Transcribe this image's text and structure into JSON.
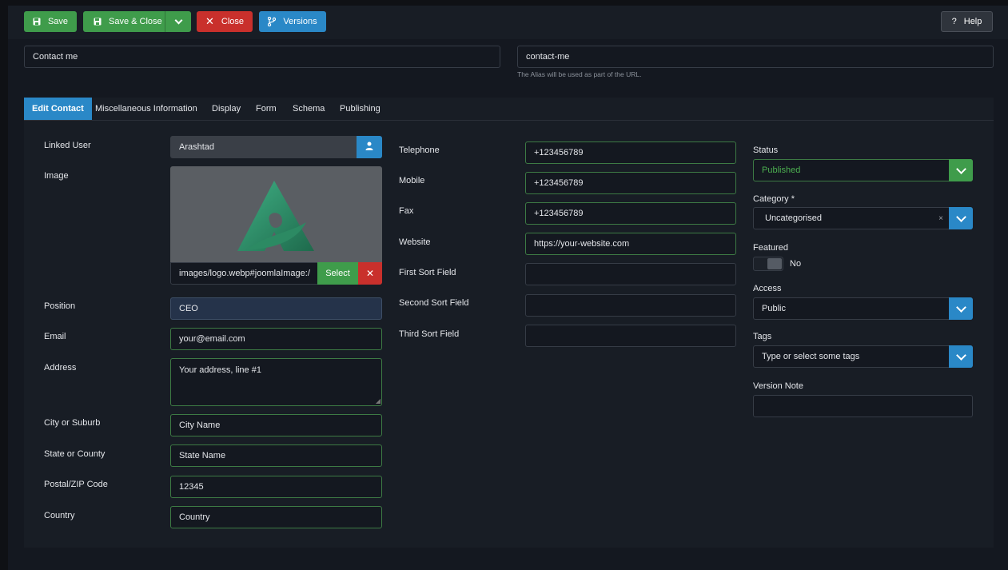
{
  "toolbar": {
    "save": "Save",
    "save_close": "Save & Close",
    "close": "Close",
    "versions": "Versions",
    "help": "Help"
  },
  "title": {
    "value": "Contact me"
  },
  "alias": {
    "value": "contact-me",
    "hint": "The Alias will be used as part of the URL."
  },
  "tabs": [
    "Edit Contact",
    "Miscellaneous Information",
    "Display",
    "Form",
    "Schema",
    "Publishing"
  ],
  "left": {
    "linked_user": {
      "label": "Linked User",
      "value": "Arashtad"
    },
    "image": {
      "label": "Image",
      "path": "images/logo.webp#joomlaImage:/",
      "select": "Select"
    },
    "position": {
      "label": "Position",
      "value": "CEO"
    },
    "email": {
      "label": "Email",
      "value": "your@email.com"
    },
    "address": {
      "label": "Address",
      "value": "Your address, line #1"
    },
    "city": {
      "label": "City or Suburb",
      "value": "City Name"
    },
    "state": {
      "label": "State or County",
      "value": "State Name"
    },
    "postal": {
      "label": "Postal/ZIP Code",
      "value": "12345"
    },
    "country": {
      "label": "Country",
      "value": "Country"
    }
  },
  "middle": {
    "telephone": {
      "label": "Telephone",
      "value": "+123456789"
    },
    "mobile": {
      "label": "Mobile",
      "value": "+123456789"
    },
    "fax": {
      "label": "Fax",
      "value": "+123456789"
    },
    "website": {
      "label": "Website",
      "value": "https://your-website.com"
    },
    "sort1": {
      "label": "First Sort Field",
      "value": ""
    },
    "sort2": {
      "label": "Second Sort Field",
      "value": ""
    },
    "sort3": {
      "label": "Third Sort Field",
      "value": ""
    }
  },
  "right": {
    "status": {
      "label": "Status",
      "value": "Published"
    },
    "category": {
      "label": "Category *",
      "value": "Uncategorised",
      "clear": "×"
    },
    "featured": {
      "label": "Featured",
      "value": "No"
    },
    "access": {
      "label": "Access",
      "value": "Public"
    },
    "tags": {
      "label": "Tags",
      "placeholder": "Type or select some tags"
    },
    "version_note": {
      "label": "Version Note",
      "value": ""
    }
  },
  "icons": {
    "save": "floppy-disk-icon",
    "caret": "chevron-down-icon",
    "close": "x-icon",
    "versions": "branch-icon",
    "help": "question-icon",
    "user": "user-icon"
  },
  "colors": {
    "green": "#3f9c4b",
    "red": "#c9302c",
    "blue": "#2a88c7",
    "published": "#4caf50"
  }
}
